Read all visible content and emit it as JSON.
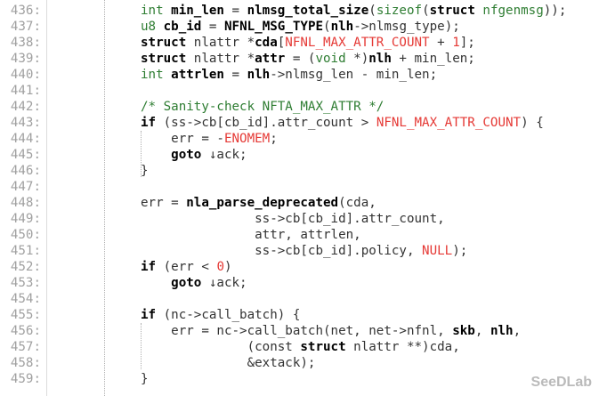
{
  "gutter": [
    "436:",
    "437:",
    "438:",
    "439:",
    "440:",
    "441:",
    "442:",
    "443:",
    "444:",
    "445:",
    "446:",
    "447:",
    "448:",
    "449:",
    "450:",
    "451:",
    "452:",
    "453:",
    "454:",
    "455:",
    "456:",
    "457:",
    "458:",
    "459:"
  ],
  "code": {
    "l436": [
      {
        "c": "ty",
        "t": "int"
      },
      {
        "c": "",
        "t": " "
      },
      {
        "c": "kw",
        "t": "min_len"
      },
      {
        "c": "",
        "t": " = "
      },
      {
        "c": "fn",
        "t": "nlmsg_total_size"
      },
      {
        "c": "",
        "t": "("
      },
      {
        "c": "ty",
        "t": "sizeof"
      },
      {
        "c": "",
        "t": "("
      },
      {
        "c": "kw",
        "t": "struct"
      },
      {
        "c": "",
        "t": " "
      },
      {
        "c": "ty",
        "t": "nfgenmsg"
      },
      {
        "c": "",
        "t": "));"
      }
    ],
    "l437": [
      {
        "c": "ty",
        "t": "u8"
      },
      {
        "c": "",
        "t": " "
      },
      {
        "c": "kw",
        "t": "cb_id"
      },
      {
        "c": "",
        "t": " = "
      },
      {
        "c": "fn",
        "t": "NFNL_MSG_TYPE"
      },
      {
        "c": "",
        "t": "("
      },
      {
        "c": "kw",
        "t": "nlh"
      },
      {
        "c": "",
        "t": "->nlmsg_type);"
      }
    ],
    "l438": [
      {
        "c": "kw",
        "t": "struct"
      },
      {
        "c": "",
        "t": " nlattr *"
      },
      {
        "c": "kw",
        "t": "cda"
      },
      {
        "c": "",
        "t": "["
      },
      {
        "c": "red",
        "t": "NFNL_MAX_ATTR_COUNT"
      },
      {
        "c": "",
        "t": " + "
      },
      {
        "c": "num",
        "t": "1"
      },
      {
        "c": "",
        "t": "];"
      }
    ],
    "l439": [
      {
        "c": "kw",
        "t": "struct"
      },
      {
        "c": "",
        "t": " nlattr *"
      },
      {
        "c": "kw",
        "t": "attr"
      },
      {
        "c": "",
        "t": " = ("
      },
      {
        "c": "ty",
        "t": "void"
      },
      {
        "c": "",
        "t": " *)"
      },
      {
        "c": "kw",
        "t": "nlh"
      },
      {
        "c": "",
        "t": " + min_len;"
      }
    ],
    "l440": [
      {
        "c": "ty",
        "t": "int"
      },
      {
        "c": "",
        "t": " "
      },
      {
        "c": "kw",
        "t": "attrlen"
      },
      {
        "c": "",
        "t": " = "
      },
      {
        "c": "kw",
        "t": "nlh"
      },
      {
        "c": "",
        "t": "->nlmsg_len - min_len;"
      }
    ],
    "l441": [],
    "l442": [
      {
        "c": "cm",
        "t": "/* Sanity-check NFTA_MAX_ATTR */"
      }
    ],
    "l443": [
      {
        "c": "kw",
        "t": "if"
      },
      {
        "c": "",
        "t": " (ss->cb[cb_id].attr_count > "
      },
      {
        "c": "red",
        "t": "NFNL_MAX_ATTR_COUNT"
      },
      {
        "c": "",
        "t": ") {"
      }
    ],
    "l444": [
      {
        "c": "",
        "t": "    err = -"
      },
      {
        "c": "red",
        "t": "ENOMEM"
      },
      {
        "c": "",
        "t": ";"
      }
    ],
    "l445": [
      {
        "c": "",
        "t": "    "
      },
      {
        "c": "kw",
        "t": "goto"
      },
      {
        "c": "",
        "t": " ↓ack;"
      }
    ],
    "l446": [
      {
        "c": "",
        "t": "}"
      }
    ],
    "l447": [],
    "l448": [
      {
        "c": "",
        "t": "err = "
      },
      {
        "c": "fn",
        "t": "nla_parse_deprecated"
      },
      {
        "c": "",
        "t": "(cda,"
      }
    ],
    "l449": [
      {
        "c": "",
        "t": "               ss->cb[cb_id].attr_count,"
      }
    ],
    "l450": [
      {
        "c": "",
        "t": "               attr, attrlen,"
      }
    ],
    "l451": [
      {
        "c": "",
        "t": "               ss->cb[cb_id].policy, "
      },
      {
        "c": "red",
        "t": "NULL"
      },
      {
        "c": "",
        "t": ");"
      }
    ],
    "l452": [
      {
        "c": "kw",
        "t": "if"
      },
      {
        "c": "",
        "t": " (err < "
      },
      {
        "c": "num",
        "t": "0"
      },
      {
        "c": "",
        "t": ")"
      }
    ],
    "l453": [
      {
        "c": "",
        "t": "    "
      },
      {
        "c": "kw",
        "t": "goto"
      },
      {
        "c": "",
        "t": " ↓ack;"
      }
    ],
    "l454": [],
    "l455": [
      {
        "c": "kw",
        "t": "if"
      },
      {
        "c": "",
        "t": " (nc->call_batch) {"
      }
    ],
    "l456": [
      {
        "c": "",
        "t": "    err = nc->call_batch(net, net->nfnl, "
      },
      {
        "c": "kw",
        "t": "skb"
      },
      {
        "c": "",
        "t": ", "
      },
      {
        "c": "kw",
        "t": "nlh"
      },
      {
        "c": "",
        "t": ","
      }
    ],
    "l457": [
      {
        "c": "",
        "t": "              (const "
      },
      {
        "c": "kw",
        "t": "struct"
      },
      {
        "c": "",
        "t": " nlattr **)cda,"
      }
    ],
    "l458": [
      {
        "c": "",
        "t": "              &extack);"
      }
    ],
    "l459": [
      {
        "c": "",
        "t": "}"
      }
    ]
  },
  "watermark": "SeeDLab"
}
